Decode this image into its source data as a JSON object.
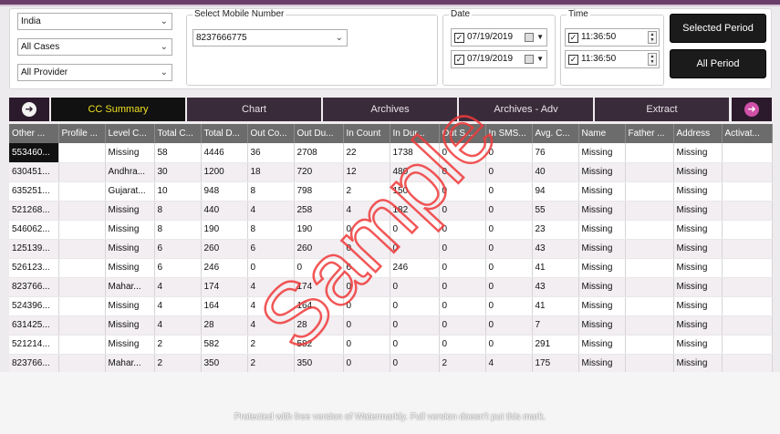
{
  "filters": {
    "country": "India",
    "cases": "All Cases",
    "provider": "All Provider",
    "mobile_group_title": "Select Mobile Number",
    "mobile_number": "8237666775",
    "date_group_title": "Date",
    "date_from": "07/19/2019",
    "date_to": "07/19/2019",
    "time_group_title": "Time",
    "time_from": "11:36:50",
    "time_to": "11:36:50",
    "selected_period_label": "Selected Period",
    "all_period_label": "All Period"
  },
  "tabs": [
    {
      "label": "CC Summary",
      "active": true
    },
    {
      "label": "Chart"
    },
    {
      "label": "Archives"
    },
    {
      "label": "Archives - Adv"
    },
    {
      "label": "Extract"
    }
  ],
  "nav": {
    "back_icon": "left-arrow-circle-icon",
    "forward_icon": "right-arrow-circle-icon",
    "forward_color": "#d050a8"
  },
  "table": {
    "columns": [
      "Other ...",
      "Profile ...",
      "Level C...",
      "Total C...",
      "Total D...",
      "Out Co...",
      "Out Du...",
      "In Count",
      "In Dur...",
      "Out S...",
      "In SMS...",
      "Avg. C...",
      "Name",
      "Father ...",
      "Address",
      "Activat..."
    ],
    "rows": [
      [
        "553460...",
        "",
        "Missing",
        "58",
        "4446",
        "36",
        "2708",
        "22",
        "1738",
        "0",
        "0",
        "76",
        "Missing",
        "",
        "Missing",
        ""
      ],
      [
        "630451...",
        "",
        "Andhra...",
        "30",
        "1200",
        "18",
        "720",
        "12",
        "480",
        "0",
        "0",
        "40",
        "Missing",
        "",
        "Missing",
        ""
      ],
      [
        "635251...",
        "",
        "Gujarat...",
        "10",
        "948",
        "8",
        "798",
        "2",
        "150",
        "0",
        "0",
        "94",
        "Missing",
        "",
        "Missing",
        ""
      ],
      [
        "521268...",
        "",
        "Missing",
        "8",
        "440",
        "4",
        "258",
        "4",
        "182",
        "0",
        "0",
        "55",
        "Missing",
        "",
        "Missing",
        ""
      ],
      [
        "546062...",
        "",
        "Missing",
        "8",
        "190",
        "8",
        "190",
        "0",
        "0",
        "0",
        "0",
        "23",
        "Missing",
        "",
        "Missing",
        ""
      ],
      [
        "125139...",
        "",
        "Missing",
        "6",
        "260",
        "6",
        "260",
        "0",
        "0",
        "0",
        "0",
        "43",
        "Missing",
        "",
        "Missing",
        ""
      ],
      [
        "526123...",
        "",
        "Missing",
        "6",
        "246",
        "0",
        "0",
        "6",
        "246",
        "0",
        "0",
        "41",
        "Missing",
        "",
        "Missing",
        ""
      ],
      [
        "823766...",
        "",
        "Mahar...",
        "4",
        "174",
        "4",
        "174",
        "0",
        "0",
        "0",
        "0",
        "43",
        "Missing",
        "",
        "Missing",
        ""
      ],
      [
        "524396...",
        "",
        "Missing",
        "4",
        "164",
        "4",
        "164",
        "0",
        "0",
        "0",
        "0",
        "41",
        "Missing",
        "",
        "Missing",
        ""
      ],
      [
        "631425...",
        "",
        "Missing",
        "4",
        "28",
        "4",
        "28",
        "0",
        "0",
        "0",
        "0",
        "7",
        "Missing",
        "",
        "Missing",
        ""
      ],
      [
        "521214...",
        "",
        "Missing",
        "2",
        "582",
        "2",
        "582",
        "0",
        "0",
        "0",
        "0",
        "291",
        "Missing",
        "",
        "Missing",
        ""
      ],
      [
        "823766...",
        "",
        "Mahar...",
        "2",
        "350",
        "2",
        "350",
        "0",
        "0",
        "2",
        "4",
        "175",
        "Missing",
        "",
        "Missing",
        ""
      ]
    ]
  },
  "watermark": {
    "stamp_text": "Sample",
    "footer_text": "Protected with free version of Watermarkly. Full version doesn't put this mark.",
    "color": "#f03a3a"
  }
}
